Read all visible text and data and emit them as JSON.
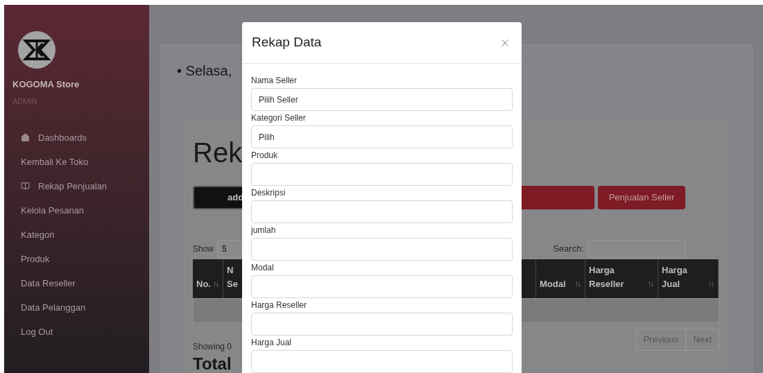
{
  "sidebar": {
    "brand": "KOGOMA Store",
    "role": "ADMIN",
    "items": [
      {
        "label": "Dashboards",
        "kind": "home"
      },
      {
        "label": "Kembali Ke Toko",
        "kind": "link"
      },
      {
        "label": "Rekap Penjualan",
        "kind": "book"
      },
      {
        "label": "Kelola Pesanan",
        "kind": "link"
      },
      {
        "label": "Kategori",
        "kind": "link"
      },
      {
        "label": "Produk",
        "kind": "link"
      },
      {
        "label": "Data Reseller",
        "kind": "link"
      },
      {
        "label": "Data Pelanggan",
        "kind": "link"
      },
      {
        "label": "Log Out",
        "kind": "link"
      }
    ]
  },
  "date_line": "• Selasa,",
  "page_title": "Rek",
  "buttons": [
    {
      "label": "add",
      "kind": "dark"
    },
    {
      "kind": "red"
    },
    {
      "label": "Penjualan Seller",
      "kind": "red"
    }
  ],
  "show": {
    "label": "Show",
    "value": "5"
  },
  "search": {
    "label": "Search:"
  },
  "table": {
    "columns": [
      {
        "lines": [
          "No."
        ]
      },
      {
        "lines": [
          "N",
          "Se"
        ]
      },
      {
        "lines": [
          "Modal"
        ]
      },
      {
        "lines": [
          "Harga",
          "Reseller"
        ]
      },
      {
        "lines": [
          "Harga",
          "Jual"
        ]
      }
    ]
  },
  "info": "Showing 0",
  "pagination": [
    "Previous",
    "Next"
  ],
  "total_heading": "Total",
  "modal": {
    "title": "Rekap Data",
    "fields": [
      {
        "label": "Nama Seller",
        "kind": "select",
        "value": "Pilih Seller"
      },
      {
        "label": "Kategori Seller",
        "kind": "select",
        "value": "Pilih"
      },
      {
        "label": "Produk",
        "kind": "text"
      },
      {
        "label": "Deskripsi",
        "kind": "text"
      },
      {
        "label": "jumlah",
        "kind": "text"
      },
      {
        "label": "Modal",
        "kind": "text"
      },
      {
        "label": "Harga Reseller",
        "kind": "text"
      },
      {
        "label": "Harga Jual",
        "kind": "text"
      }
    ]
  }
}
